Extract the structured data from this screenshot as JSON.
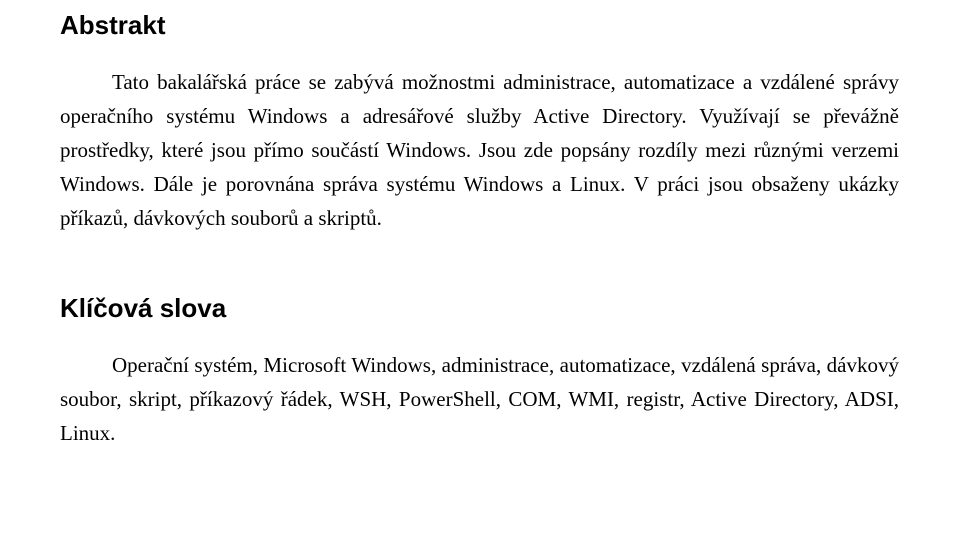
{
  "section1": {
    "heading": "Abstrakt",
    "paragraph": "Tato bakalářská práce se zabývá možnostmi administrace, automatizace a vzdálené správy operačního systému Windows a adresářové služby Active Directory. Využívají se převážně prostředky, které jsou přímo součástí Windows. Jsou zde popsány rozdíly mezi různými verzemi Windows. Dále je porovnána správa systému Windows a Linux. V práci jsou obsaženy ukázky příkazů, dávkových souborů a skriptů."
  },
  "section2": {
    "heading": "Klíčová slova",
    "paragraph": "Operační systém, Microsoft Windows, administrace, automatizace, vzdálená správa, dávkový soubor, skript, příkazový řádek, WSH, PowerShell, COM, WMI, registr, Active Directory, ADSI, Linux."
  }
}
